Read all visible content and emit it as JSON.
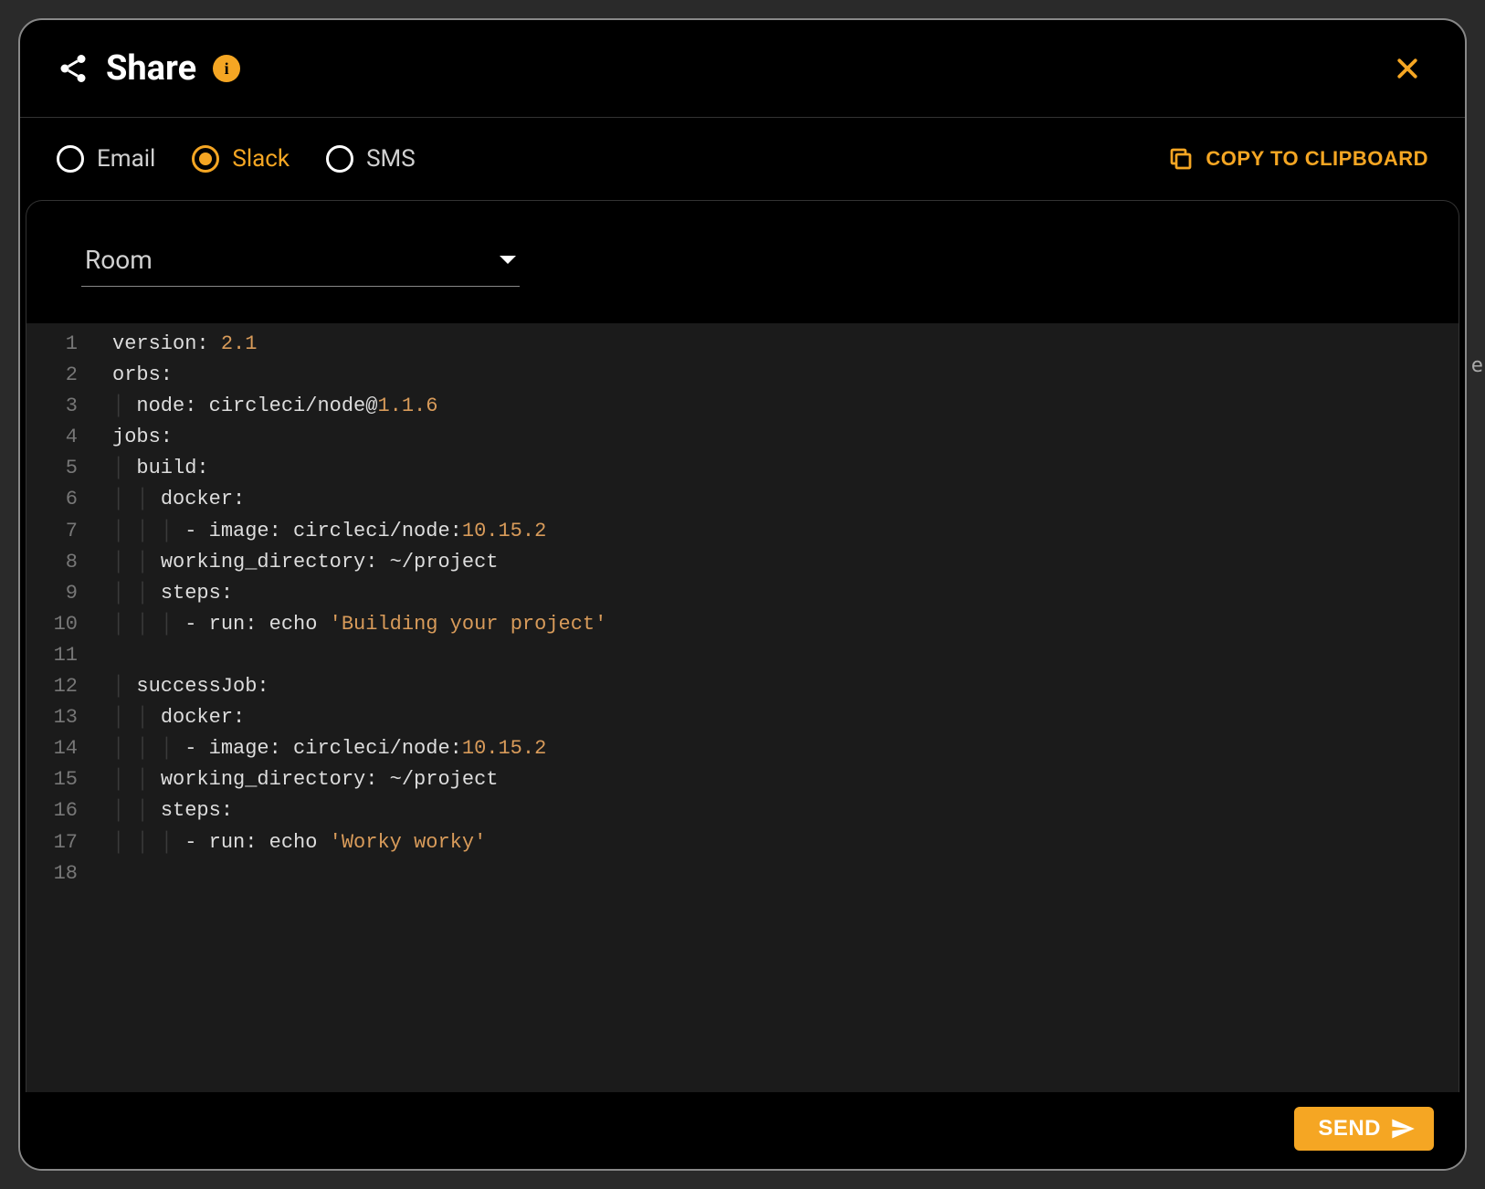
{
  "header": {
    "title": "Share",
    "info_label": "i"
  },
  "methods": {
    "options": [
      {
        "id": "email",
        "label": "Email",
        "selected": false
      },
      {
        "id": "slack",
        "label": "Slack",
        "selected": true
      },
      {
        "id": "sms",
        "label": "SMS",
        "selected": false
      }
    ],
    "copy_label": "COPY TO CLIPBOARD"
  },
  "room": {
    "label": "Room"
  },
  "editor": {
    "lines": [
      {
        "n": 1,
        "segments": [
          [
            "version: ",
            "key"
          ],
          [
            "2.1",
            "num"
          ]
        ],
        "active": true
      },
      {
        "n": 2,
        "segments": [
          [
            "orbs:",
            "key"
          ]
        ]
      },
      {
        "n": 3,
        "segments": [
          [
            "│ ",
            "guide"
          ],
          [
            "node: circleci/node@",
            "key"
          ],
          [
            "1.1.6",
            "num"
          ]
        ]
      },
      {
        "n": 4,
        "segments": [
          [
            "jobs:",
            "key"
          ]
        ]
      },
      {
        "n": 5,
        "segments": [
          [
            "│ ",
            "guide"
          ],
          [
            "build:",
            "key"
          ]
        ]
      },
      {
        "n": 6,
        "segments": [
          [
            "│ │ ",
            "guide"
          ],
          [
            "docker:",
            "key"
          ]
        ]
      },
      {
        "n": 7,
        "segments": [
          [
            "│ │ │ ",
            "guide"
          ],
          [
            "- image: circleci/node:",
            "key"
          ],
          [
            "10.15.2",
            "num"
          ]
        ]
      },
      {
        "n": 8,
        "segments": [
          [
            "│ │ ",
            "guide"
          ],
          [
            "working_directory: ~/project",
            "key"
          ]
        ]
      },
      {
        "n": 9,
        "segments": [
          [
            "│ │ ",
            "guide"
          ],
          [
            "steps:",
            "key"
          ]
        ]
      },
      {
        "n": 10,
        "segments": [
          [
            "│ │ │ ",
            "guide"
          ],
          [
            "- run: echo ",
            "key"
          ],
          [
            "'Building your project'",
            "str"
          ]
        ]
      },
      {
        "n": 11,
        "segments": [
          [
            "",
            "key"
          ]
        ]
      },
      {
        "n": 12,
        "segments": [
          [
            "│ ",
            "guide"
          ],
          [
            "successJob:",
            "key"
          ]
        ]
      },
      {
        "n": 13,
        "segments": [
          [
            "│ │ ",
            "guide"
          ],
          [
            "docker:",
            "key"
          ]
        ]
      },
      {
        "n": 14,
        "segments": [
          [
            "│ │ │ ",
            "guide"
          ],
          [
            "- image: circleci/node:",
            "key"
          ],
          [
            "10.15.2",
            "num"
          ]
        ]
      },
      {
        "n": 15,
        "segments": [
          [
            "│ │ ",
            "guide"
          ],
          [
            "working_directory: ~/project",
            "key"
          ]
        ]
      },
      {
        "n": 16,
        "segments": [
          [
            "│ │ ",
            "guide"
          ],
          [
            "steps:",
            "key"
          ]
        ]
      },
      {
        "n": 17,
        "segments": [
          [
            "│ │ │ ",
            "guide"
          ],
          [
            "- run: echo ",
            "key"
          ],
          [
            "'Worky worky'",
            "str"
          ]
        ]
      },
      {
        "n": 18,
        "segments": [
          [
            "",
            "key"
          ]
        ]
      }
    ]
  },
  "footer": {
    "send_label": "SEND"
  },
  "colors": {
    "accent": "#f5a623",
    "bg_dialog": "#000000",
    "bg_editor": "#1b1b1b"
  },
  "stray": "e"
}
